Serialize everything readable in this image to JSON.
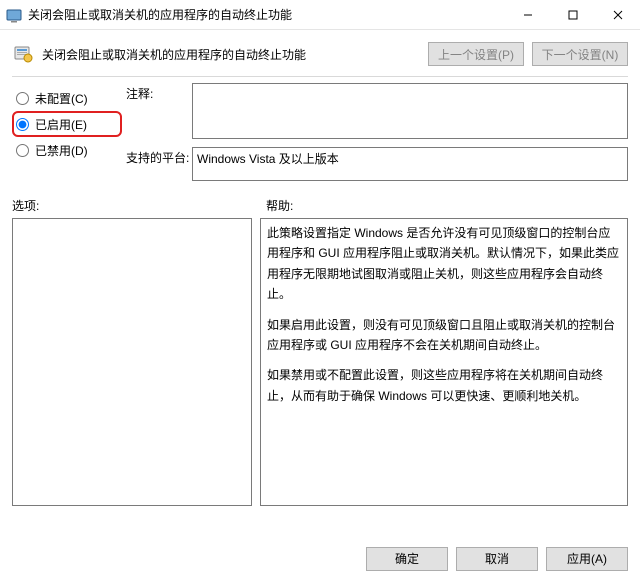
{
  "window": {
    "title": "关闭会阻止或取消关机的应用程序的自动终止功能"
  },
  "header": {
    "policy_name": "关闭会阻止或取消关机的应用程序的自动终止功能",
    "prev_setting": "上一个设置(P)",
    "next_setting": "下一个设置(N)"
  },
  "radios": {
    "not_configured": "未配置(C)",
    "enabled": "已启用(E)",
    "disabled": "已禁用(D)",
    "selected": "enabled"
  },
  "fields": {
    "comment_label": "注释:",
    "comment_value": "",
    "platform_label": "支持的平台:",
    "platform_value": "Windows Vista 及以上版本"
  },
  "sections": {
    "options_label": "选项:",
    "help_label": "帮助:"
  },
  "help_text": "此策略设置指定 Windows 是否允许没有可见顶级窗口的控制台应用程序和 GUI 应用程序阻止或取消关机。默认情况下，如果此类应用程序无限期地试图取消或阻止关机，则这些应用程序会自动终止。\n\n如果启用此设置，则没有可见顶级窗口且阻止或取消关机的控制台应用程序或 GUI 应用程序不会在关机期间自动终止。\n\n如果禁用或不配置此设置，则这些应用程序将在关机期间自动终止，从而有助于确保 Windows 可以更快速、更顺利地关机。",
  "footer": {
    "ok": "确定",
    "cancel": "取消",
    "apply": "应用(A)"
  }
}
